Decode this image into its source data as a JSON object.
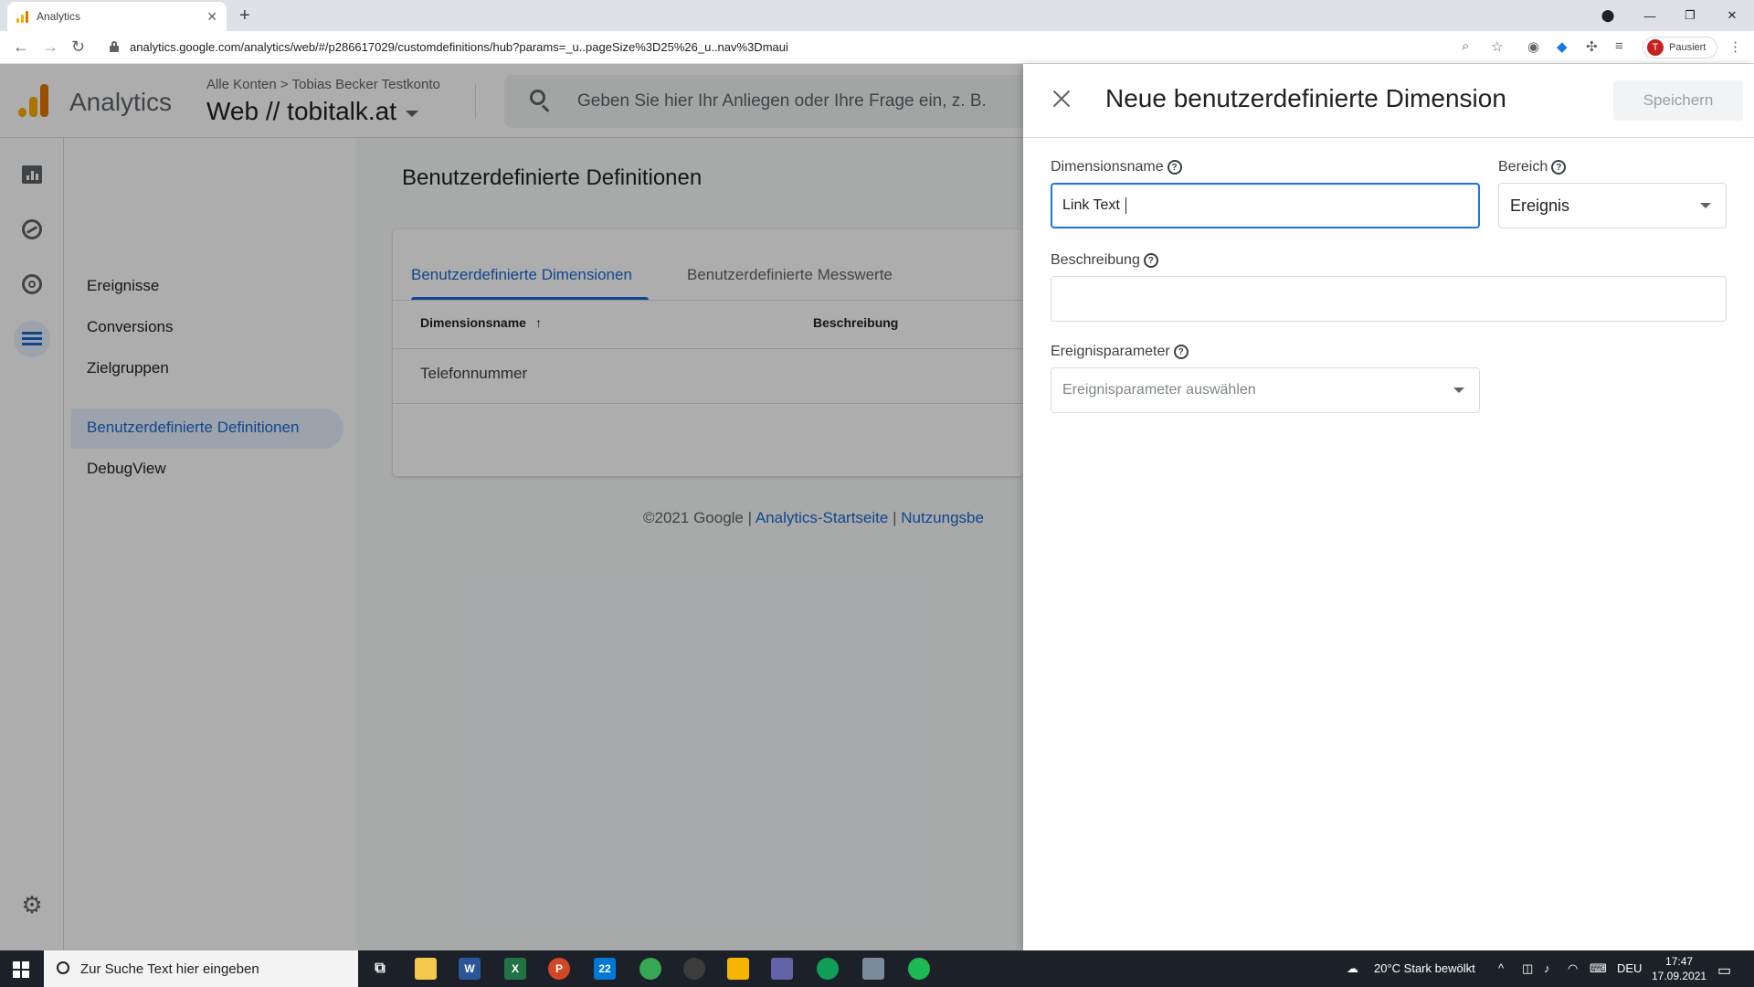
{
  "browser": {
    "tab_title": "Analytics",
    "url": "analytics.google.com/analytics/web/#/p286617029/customdefinitions/hub?params=_u..pageSize%3D25%26_u..nav%3Dmaui",
    "profile_label": "Pausiert",
    "profile_initial": "T"
  },
  "header": {
    "product": "Analytics",
    "breadcrumb": "Alle Konten > Tobias Becker Testkonto",
    "property": "Web // tobitalk.at",
    "search_placeholder": "Geben Sie hier Ihr Anliegen oder Ihre Frage ein, z. B."
  },
  "sidenav": {
    "items": [
      {
        "label": "Ereignisse"
      },
      {
        "label": "Conversions"
      },
      {
        "label": "Zielgruppen"
      },
      {
        "label": "Benutzerdefinierte Definitionen"
      },
      {
        "label": "DebugView"
      }
    ]
  },
  "main": {
    "title": "Benutzerdefinierte Definitionen",
    "tabs": [
      {
        "label": "Benutzerdefinierte Dimensionen"
      },
      {
        "label": "Benutzerdefinierte Messwerte"
      }
    ],
    "columns": [
      "Dimensionsname",
      "Beschreibung"
    ],
    "rows": [
      {
        "name": "Telefonnummer"
      }
    ],
    "footer": {
      "copyright": "©2021 Google |",
      "link1": "Analytics-Startseite",
      "sep": "|",
      "link2": "Nutzungsbe"
    }
  },
  "panel": {
    "title": "Neue benutzerdefinierte Dimension",
    "save_label": "Speichern",
    "dimension_name_label": "Dimensionsname",
    "dimension_name_value": "Link Text",
    "scope_label": "Bereich",
    "scope_value": "Ereignis",
    "description_label": "Beschreibung",
    "description_value": "",
    "event_param_label": "Ereignisparameter",
    "event_param_placeholder": "Ereignisparameter auswählen"
  },
  "taskbar": {
    "search_placeholder": "Zur Suche Text hier eingeben",
    "weather": "20°C  Stark bewölkt",
    "lang": "DEU",
    "time": "17:47",
    "date": "17.09.2021",
    "mail_badge": "22"
  },
  "colors": {
    "accent": "#1967d2",
    "logo_orange": "#f9ab00",
    "logo_dark": "#e37400"
  }
}
